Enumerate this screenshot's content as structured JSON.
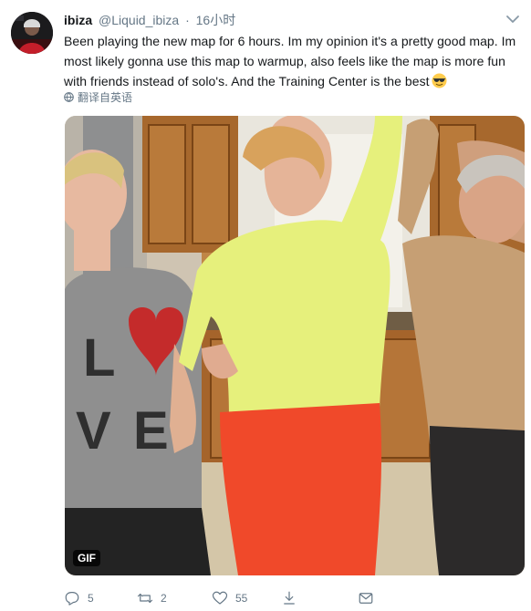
{
  "author": {
    "display_name": "ibiza",
    "handle": "@Liquid_ibiza",
    "separator": "·",
    "timestamp": "16小时"
  },
  "tweet": {
    "text": "Been playing the new map for 6 hours. Im my opinion it's a pretty good map. Im most likely gonna use this map to warmup, also feels like the map is more fun with friends instead of solo's. And the Training Center is the best",
    "emoji": "smiling-face-with-sunglasses",
    "translate_label": "翻译自英语"
  },
  "media": {
    "badge": "GIF"
  },
  "actions": {
    "replies": "5",
    "retweets": "2",
    "likes": "55"
  },
  "icons": {
    "avatar": "avatar-icon",
    "caret": "chevron-down-icon",
    "globe": "globe-icon",
    "reply": "reply-icon",
    "retweet": "retweet-icon",
    "like": "heart-icon",
    "share": "share-icon"
  },
  "colors": {
    "text": "#14171a",
    "muted": "#657786",
    "link": "#1da1f2"
  }
}
